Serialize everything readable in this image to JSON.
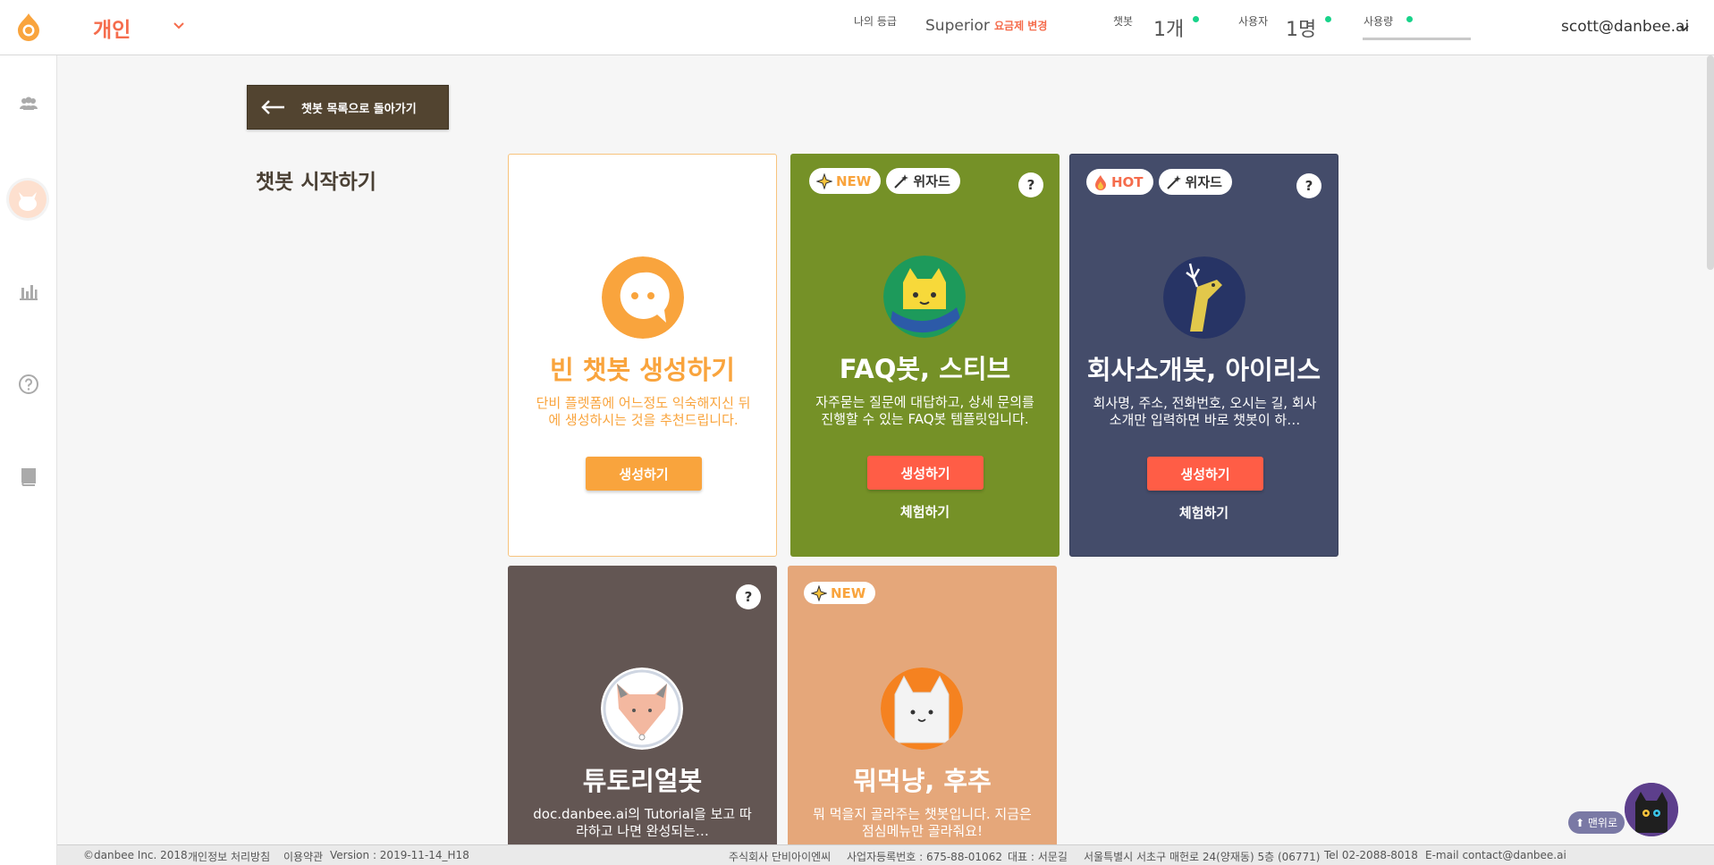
{
  "header": {
    "workspace": "개인",
    "grade_label": "나의 등급",
    "plan_name": "Superior",
    "plan_change": "요금제 변경",
    "chatbot_label": "챗봇",
    "chatbot_count": "1개",
    "users_label": "사용자",
    "users_count": "1명",
    "usage_label": "사용량",
    "user_email": "scott@danbee.ai"
  },
  "sidebar": {
    "items": [
      "people-icon",
      "avatar",
      "bar-chart-icon",
      "help-circle-icon",
      "book-icon"
    ]
  },
  "main": {
    "back_button": "챗봇 목록으로 돌아가기",
    "page_title": "챗봇 시작하기",
    "cards": [
      {
        "title": "빈 챗봇 생성하기",
        "description": "단비 플렛폼에 어느정도 익숙해지신 뒤에 생성하시는 것을 추천드립니다.",
        "create_label": "생성하기"
      },
      {
        "badge_new": "NEW",
        "badge_wizard": "위자드",
        "help": "?",
        "title": "FAQ봇, 스티브",
        "description": "자주묻는 질문에 대답하고, 상세 문의를 진행할 수 있는 FAQ봇 템플릿입니다.",
        "create_label": "생성하기",
        "try_label": "체험하기"
      },
      {
        "badge_hot": "HOT",
        "badge_wizard": "위자드",
        "help": "?",
        "title": "회사소개봇, 아이리스",
        "description": "회사명, 주소, 전화번호, 오시는 길, 회사소개만 입력하면 바로 챗봇이 하…",
        "create_label": "생성하기",
        "try_label": "체험하기"
      },
      {
        "help": "?",
        "title": "튜토리얼봇",
        "description": "doc.danbee.ai의 Tutorial을 보고 따라하고 나면 완성되는…"
      },
      {
        "badge_new": "NEW",
        "title": "뭐먹냥, 후추",
        "description": "뭐 먹을지 골라주는 챗봇입니다. 지금은 점심메뉴만 골라줘요!"
      }
    ]
  },
  "footer": {
    "copyright": "©danbee Inc. 2018",
    "privacy": "개인정보 처리방침",
    "terms": "이용약관",
    "version": "Version : 2019-11-14_H18",
    "company": "주식회사 단비아이엔씨",
    "biz_no": "사업자등록번호 : 675-88-01062",
    "ceo": "대표 : 서문길",
    "address": "서울특별시 서초구 매헌로 24(양재동) 5층 (06771)",
    "tel": "Tel 02-2088-8018",
    "email": "E-mail contact@danbee.ai"
  },
  "floating": {
    "top_button": "⬆ 맨위로"
  },
  "colors": {
    "accent": "#f56c4c",
    "orange": "#f9a43d",
    "faq_green": "#759127",
    "intro_navy": "#444c6a",
    "tutorial_brown": "#635653",
    "lunch_peach": "#e5a77a",
    "back_button": "#524430",
    "status_green": "#18d38a"
  }
}
